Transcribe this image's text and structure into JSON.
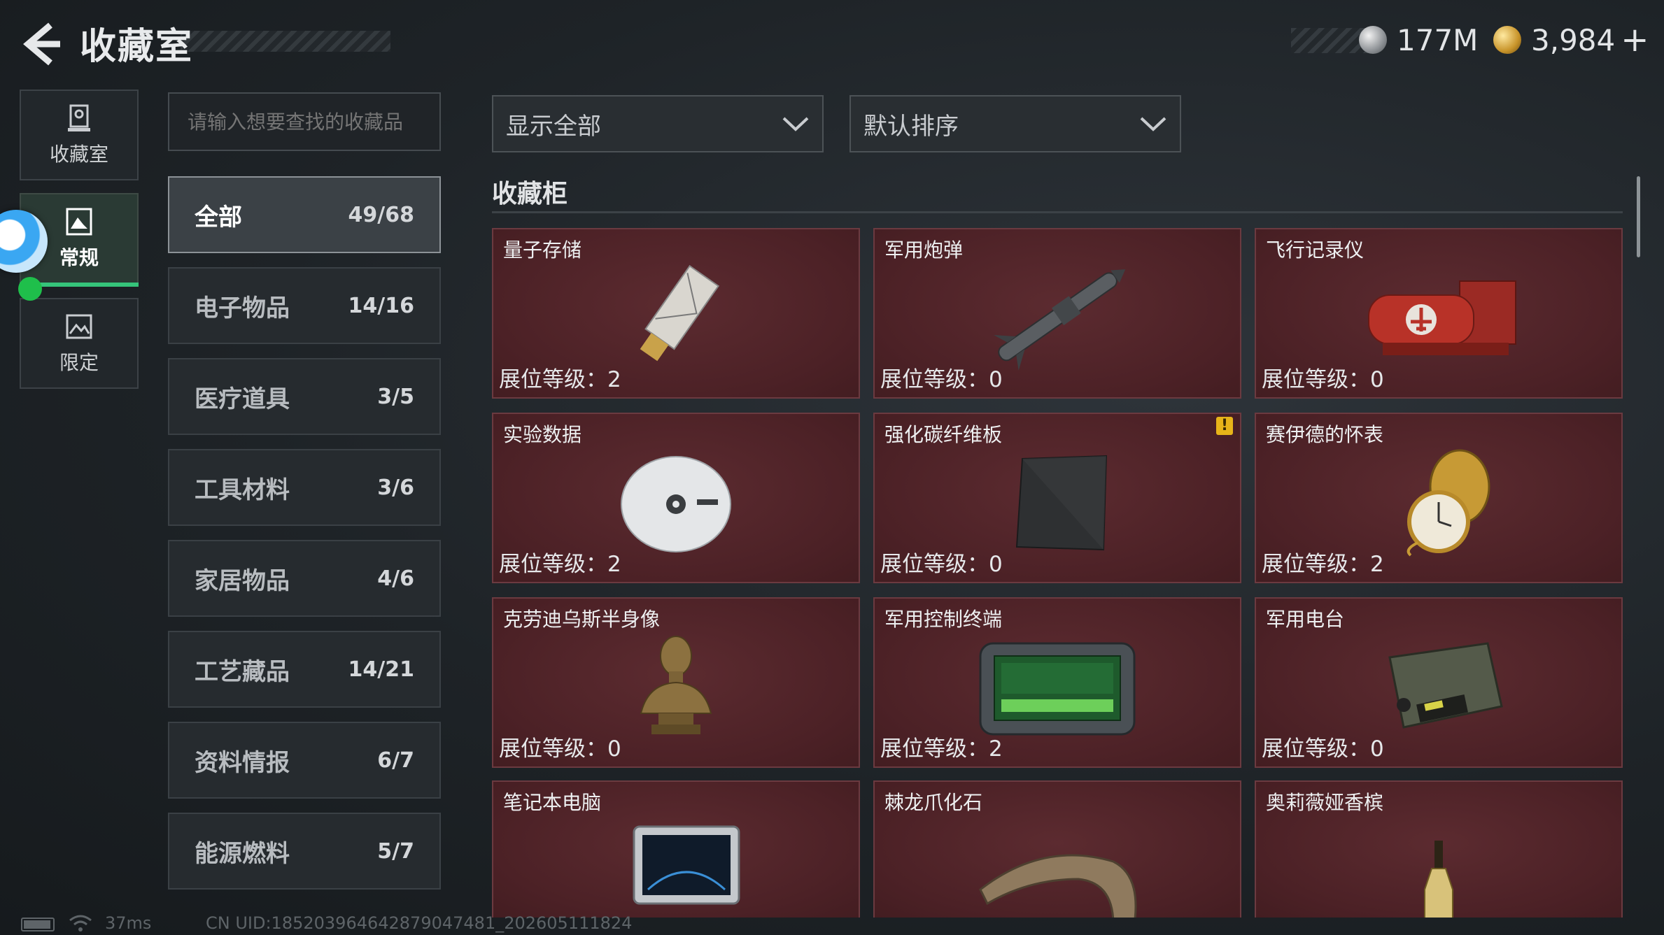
{
  "header": {
    "title": "收藏室",
    "currencies": [
      {
        "icon": "silver-coin-icon",
        "value": "177M"
      },
      {
        "icon": "gold-coin-icon",
        "value": "3,984"
      }
    ],
    "add_label": "+"
  },
  "rail": {
    "items": [
      {
        "label": "收藏室",
        "icon": "trophy-icon",
        "active": false
      },
      {
        "label": "常规",
        "icon": "picture-icon",
        "active": true
      },
      {
        "label": "限定",
        "icon": "landscape-icon",
        "active": false
      }
    ]
  },
  "search": {
    "placeholder": "请输入想要查找的收藏品"
  },
  "categories": [
    {
      "name": "全部",
      "count": "49/68",
      "active": true
    },
    {
      "name": "电子物品",
      "count": "14/16"
    },
    {
      "name": "医疗道具",
      "count": "3/5"
    },
    {
      "name": "工具材料",
      "count": "3/6"
    },
    {
      "name": "家居物品",
      "count": "4/6"
    },
    {
      "name": "工艺藏品",
      "count": "14/21"
    },
    {
      "name": "资料情报",
      "count": "6/7"
    },
    {
      "name": "能源燃料",
      "count": "5/7"
    }
  ],
  "filters": {
    "display": "显示全部",
    "sort": "默认排序"
  },
  "section_title": "收藏柜",
  "level_prefix": "展位等级：",
  "items": [
    {
      "name": "量子存储",
      "level": "2",
      "icon": "usb-drive-icon"
    },
    {
      "name": "军用炮弹",
      "level": "0",
      "icon": "missile-icon"
    },
    {
      "name": "飞行记录仪",
      "level": "0",
      "icon": "flight-recorder-icon"
    },
    {
      "name": "实验数据",
      "level": "2",
      "icon": "disc-icon"
    },
    {
      "name": "强化碳纤维板",
      "level": "0",
      "icon": "carbon-plate-icon",
      "warning": "!"
    },
    {
      "name": "赛伊德的怀表",
      "level": "2",
      "icon": "pocket-watch-icon"
    },
    {
      "name": "克劳迪乌斯半身像",
      "level": "0",
      "icon": "bust-icon"
    },
    {
      "name": "军用控制终端",
      "level": "2",
      "icon": "control-terminal-icon"
    },
    {
      "name": "军用电台",
      "level": "0",
      "icon": "military-radio-icon"
    },
    {
      "name": "笔记本电脑",
      "icon": "laptop-icon"
    },
    {
      "name": "棘龙爪化石",
      "icon": "claw-fossil-icon"
    },
    {
      "name": "奥莉薇娅香槟",
      "icon": "champagne-icon"
    }
  ],
  "status": {
    "ping": "37ms",
    "uid": "CN UID:18520396464287904748​1_202605111824"
  }
}
